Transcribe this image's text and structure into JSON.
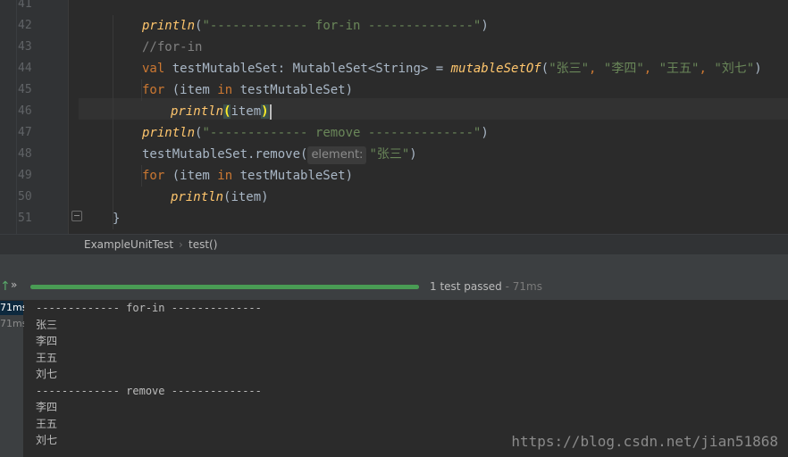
{
  "editor": {
    "line_numbers": [
      "41",
      "42",
      "43",
      "44",
      "45",
      "46",
      "47",
      "48",
      "49",
      "50",
      "51"
    ],
    "lines": [
      {
        "indent": 0,
        "parts": []
      },
      {
        "indent": 2,
        "parts": [
          {
            "t": "println",
            "c": "fn"
          },
          {
            "t": "(",
            "c": "p"
          },
          {
            "t": "\"------------- for-in --------------\"",
            "c": "str"
          },
          {
            "t": ")",
            "c": "p"
          }
        ]
      },
      {
        "indent": 2,
        "parts": [
          {
            "t": "//for-in",
            "c": "cmt"
          }
        ]
      },
      {
        "indent": 2,
        "parts": [
          {
            "t": "val ",
            "c": "kw"
          },
          {
            "t": "testMutableSet: MutableSet<String> = ",
            "c": "p"
          },
          {
            "t": "mutableSetOf",
            "c": "fn"
          },
          {
            "t": "(",
            "c": "p"
          },
          {
            "t": "\"张三\"",
            "c": "str"
          },
          {
            "t": ", ",
            "c": "kw"
          },
          {
            "t": "\"李四\"",
            "c": "str"
          },
          {
            "t": ", ",
            "c": "kw"
          },
          {
            "t": "\"王五\"",
            "c": "str"
          },
          {
            "t": ", ",
            "c": "kw"
          },
          {
            "t": "\"刘七\"",
            "c": "str"
          },
          {
            "t": ")",
            "c": "p"
          }
        ]
      },
      {
        "indent": 2,
        "parts": [
          {
            "t": "for ",
            "c": "kw"
          },
          {
            "t": "(item ",
            "c": "p"
          },
          {
            "t": "in ",
            "c": "kw"
          },
          {
            "t": "testMutableSet)",
            "c": "p"
          }
        ]
      },
      {
        "indent": 3,
        "parts": [
          {
            "t": "println",
            "c": "fn"
          },
          {
            "t": "(",
            "c": "bm"
          },
          {
            "t": "item",
            "c": "p"
          },
          {
            "t": ")",
            "c": "bm"
          },
          {
            "t": "",
            "c": "caret"
          }
        ]
      },
      {
        "indent": 2,
        "parts": [
          {
            "t": "println",
            "c": "fn"
          },
          {
            "t": "(",
            "c": "p"
          },
          {
            "t": "\"------------- remove --------------\"",
            "c": "str"
          },
          {
            "t": ")",
            "c": "p"
          }
        ]
      },
      {
        "indent": 2,
        "parts": [
          {
            "t": "testMutableSet.remove(",
            "c": "p"
          },
          {
            "t": "element:",
            "c": "hint"
          },
          {
            "t": "\"张三\"",
            "c": "str"
          },
          {
            "t": ")",
            "c": "p"
          }
        ]
      },
      {
        "indent": 2,
        "parts": [
          {
            "t": "for ",
            "c": "kw"
          },
          {
            "t": "(item ",
            "c": "p"
          },
          {
            "t": "in ",
            "c": "kw"
          },
          {
            "t": "testMutableSet)",
            "c": "p"
          }
        ]
      },
      {
        "indent": 3,
        "parts": [
          {
            "t": "println",
            "c": "fn"
          },
          {
            "t": "(item)",
            "c": "p"
          }
        ]
      },
      {
        "indent": 1,
        "parts": [
          {
            "t": "}",
            "c": "p"
          }
        ]
      }
    ]
  },
  "breadcrumb": {
    "class_name": "ExampleUnitTest",
    "separator": "›",
    "method_name": "test()"
  },
  "run_toolbar": {
    "expand_glyph": "»",
    "progress": 1.0,
    "status": "1 test passed",
    "duration": " - 71ms"
  },
  "test_tree": {
    "times": [
      "71ms",
      "71ms"
    ]
  },
  "console": {
    "lines": [
      "------------- for-in --------------",
      "张三",
      "李四",
      "王五",
      "刘七",
      "------------- remove --------------",
      "李四",
      "王五",
      "刘七"
    ]
  },
  "watermark": "https://blog.csdn.net/jian51868",
  "colors": {
    "background": "#2b2b2b",
    "keyword": "#cc7832",
    "function": "#ffc66d",
    "string": "#6a8759",
    "comment": "#808080",
    "progress": "#499c54"
  }
}
